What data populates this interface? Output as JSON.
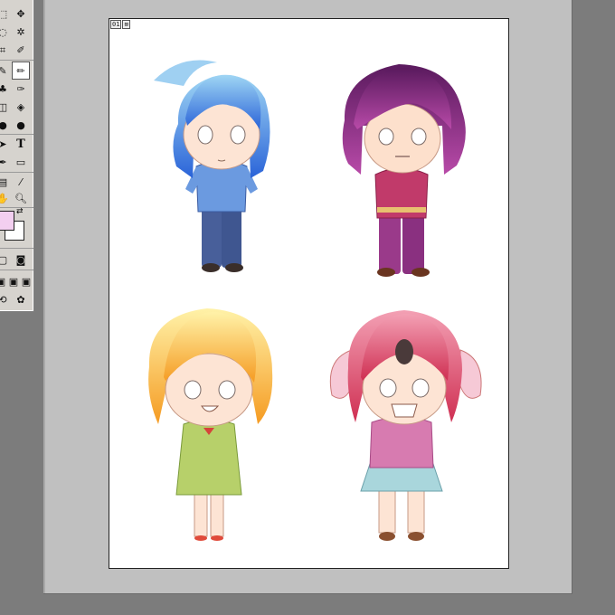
{
  "document": {
    "badge_page": "01",
    "badge_icon": "image-icon"
  },
  "toolbox": {
    "foreground_color": "#f3cff0",
    "background_color": "#ffffff",
    "tools": [
      "marquee-icon",
      "move-icon",
      "lasso-icon",
      "magic-wand-icon",
      "crop-icon",
      "eyedropper-icon",
      "healing-icon",
      "brush-icon",
      "stamp-icon",
      "history-brush-icon",
      "eraser-icon",
      "bucket-icon",
      "blur-icon",
      "dodge-icon",
      "path-select-icon",
      "type-icon",
      "pen-icon",
      "shape-icon",
      "notes-icon",
      "eyedropper-icon",
      "hand-icon",
      "zoom-icon"
    ]
  },
  "characters": [
    {
      "name": "blue-hair-boy",
      "hair": "#5aa6e8",
      "shirt": "#6b9ae0",
      "pants": "#485f9a"
    },
    {
      "name": "purple-hair-boy",
      "hair": "#7b2c84",
      "shirt": "#c13a6a",
      "pants": "#9a3a8a"
    },
    {
      "name": "blonde-girl",
      "hair": "#f5c04a",
      "dress": "#b7d06a"
    },
    {
      "name": "pink-bunny-girl",
      "hair": "#e56a86",
      "top": "#d77bb0",
      "skirt": "#a9d6dc"
    }
  ]
}
